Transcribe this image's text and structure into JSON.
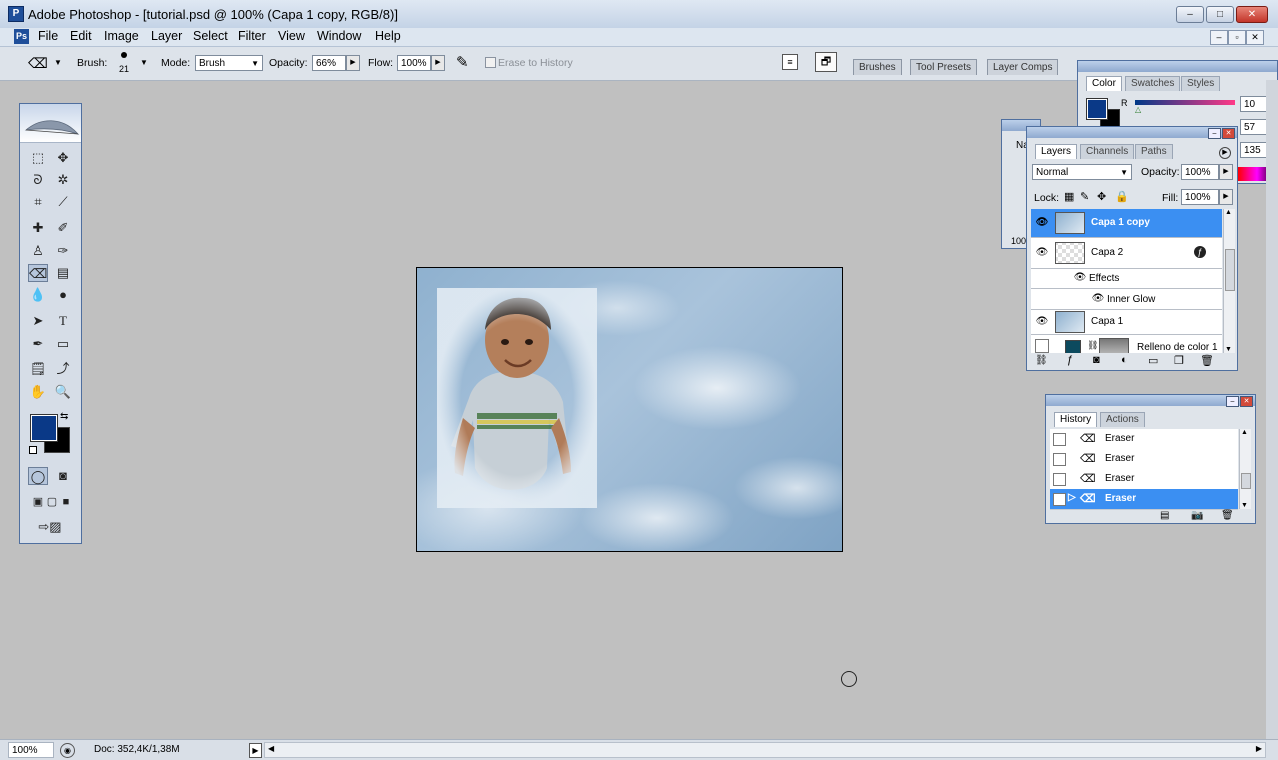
{
  "window": {
    "title": "Adobe Photoshop - [tutorial.psd @ 100% (Capa 1 copy, RGB/8)]",
    "minimize": "–",
    "maximize": "□",
    "close": "✕",
    "doc_min": "–",
    "doc_restore": "▫",
    "doc_close": "✕"
  },
  "menu": [
    "File",
    "Edit",
    "Image",
    "Layer",
    "Select",
    "Filter",
    "View",
    "Window",
    "Help"
  ],
  "options": {
    "brush_label": "Brush:",
    "brush_size": "21",
    "mode_label": "Mode:",
    "mode_value": "Brush",
    "opacity_label": "Opacity:",
    "opacity_value": "66%",
    "flow_label": "Flow:",
    "flow_value": "100%",
    "erase_history": "Erase to History"
  },
  "dock_tabs": [
    "Brushes",
    "Tool Presets",
    "Layer Comps"
  ],
  "color_panel": {
    "tabs": [
      "Color",
      "Swatches",
      "Styles"
    ],
    "r_label": "R",
    "r": "10",
    "g": "57",
    "b": "135",
    "foreground": "#0a3987",
    "background": "#000000"
  },
  "navigator": {
    "tab_partial": "Na",
    "zoom_partial": "100"
  },
  "layers_panel": {
    "tabs": [
      "Layers",
      "Channels",
      "Paths"
    ],
    "blend_mode": "Normal",
    "opacity_label": "Opacity:",
    "opacity": "100%",
    "lock_label": "Lock:",
    "fill_label": "Fill:",
    "fill": "100%",
    "layers": [
      {
        "name": "Capa 1 copy",
        "selected": true
      },
      {
        "name": "Capa 2",
        "selected": false
      },
      {
        "name": "Effects",
        "selected": false
      },
      {
        "name": "Inner Glow",
        "selected": false
      },
      {
        "name": "Capa 1",
        "selected": false
      },
      {
        "name": "Relleno de color 1",
        "selected": false
      }
    ]
  },
  "history_panel": {
    "tabs": [
      "History",
      "Actions"
    ],
    "items": [
      "Eraser",
      "Eraser",
      "Eraser",
      "Eraser"
    ]
  },
  "status": {
    "zoom": "100%",
    "doc_info": "Doc: 352,4K/1,38M"
  },
  "colors": {
    "selection_blue": "#3b8ff2",
    "panel_border": "#4f6f9f"
  }
}
